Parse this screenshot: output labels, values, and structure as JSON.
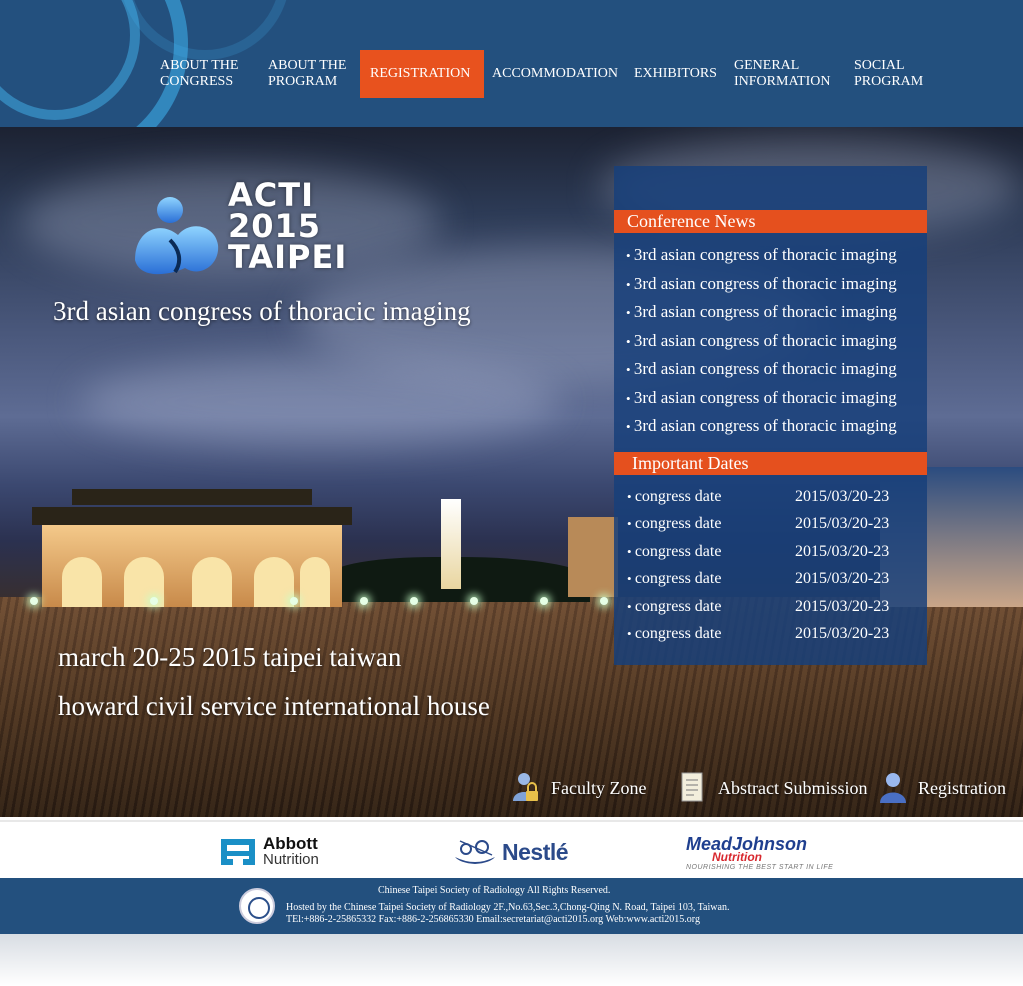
{
  "nav": {
    "items": [
      {
        "label": "ABOUT THE CONGRESS"
      },
      {
        "label": "ABOUT THE PROGRAM"
      },
      {
        "label": "REGISTRATION"
      },
      {
        "label": "ACCOMMODATION"
      },
      {
        "label": "EXHIBITORS"
      },
      {
        "label": "GENERAL INFORMATION"
      },
      {
        "label": "SOCIAL PROGRAM"
      }
    ],
    "active": "REGISTRATION",
    "active_color": "#e8521e"
  },
  "logo": {
    "line1": "ACTI",
    "line2": "2015",
    "line3": "TAIPEI",
    "icon": "acti-logo-icon"
  },
  "hero": {
    "subtitle": "3rd asian congress of thoracic imaging",
    "date_location": "march 20-25 2015 taipei taiwan",
    "venue": "howard civil service international house"
  },
  "conference_news": {
    "heading": "Conference News",
    "items": [
      "3rd asian congress of thoracic imaging",
      "3rd asian congress of thoracic imaging",
      "3rd asian congress of thoracic imaging",
      "3rd asian congress of thoracic imaging",
      "3rd asian congress of thoracic imaging",
      "3rd asian congress of thoracic imaging",
      "3rd asian congress of thoracic imaging"
    ]
  },
  "important_dates": {
    "heading": "Important Dates",
    "items": [
      {
        "label": "congress date",
        "value": "2015/03/20-23"
      },
      {
        "label": "congress date",
        "value": "2015/03/20-23"
      },
      {
        "label": "congress date",
        "value": "2015/03/20-23"
      },
      {
        "label": "congress date",
        "value": "2015/03/20-23"
      },
      {
        "label": "congress date",
        "value": "2015/03/20-23"
      },
      {
        "label": "congress date",
        "value": "2015/03/20-23"
      }
    ]
  },
  "quick_links": [
    {
      "label": "Faculty Zone",
      "icon": "faculty-lock-icon"
    },
    {
      "label": "Abstract Submission",
      "icon": "document-icon"
    },
    {
      "label": "Registration",
      "icon": "user-icon"
    }
  ],
  "sponsors": {
    "abbott": {
      "name": "Abbott",
      "sub": "Nutrition"
    },
    "nestle": {
      "name": "Nestlé"
    },
    "meadjohnson": {
      "name": "MeadJohnson",
      "sub": "Nutrition",
      "tagline": "NOURISHING THE BEST START IN LIFE"
    }
  },
  "footer": {
    "line1": "Chinese Taipei Society of Radiology  All Rights Reserved.",
    "line2": "Hosted by the Chinese Taipei Society of Radiology   2F.,No.63,Sec.3,Chong-Qing N. Road, Taipei 103, Taiwan.",
    "line3": "TEl:+886-2-25865332 Fax:+886-2-256865330     Email:secretariat@acti2015.org Web:www.acti2015.org"
  },
  "colors": {
    "header_bg": "#23507e",
    "accent": "#e5501e",
    "panel_bg": "#173f7a"
  }
}
